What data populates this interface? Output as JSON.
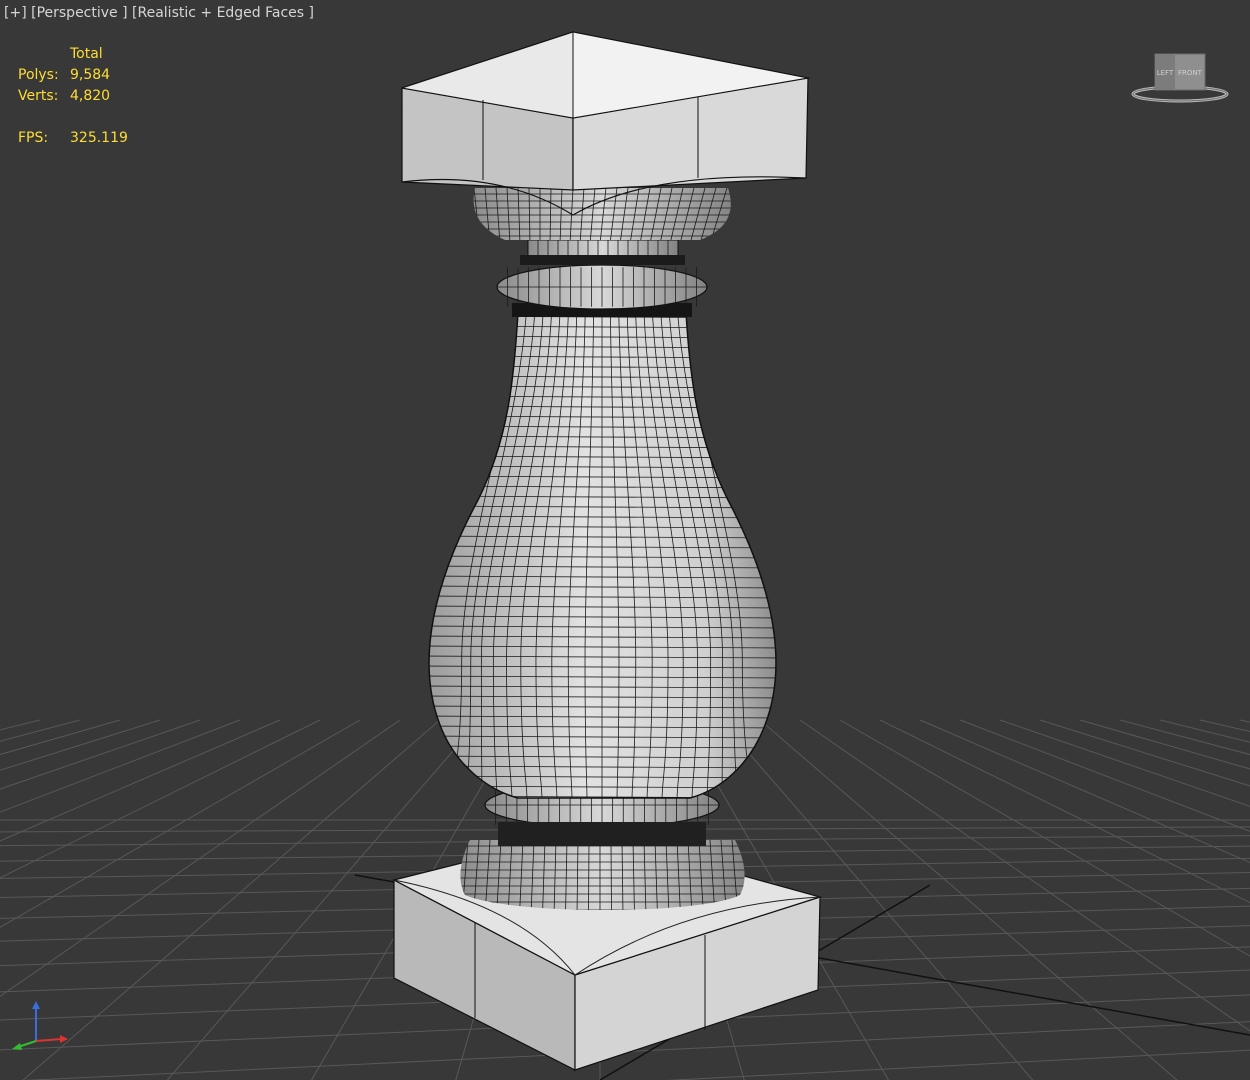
{
  "viewport": {
    "menu_label": "[+]",
    "view_label": "[Perspective ]",
    "shading_label": "[Realistic + Edged Faces ]"
  },
  "stats": {
    "header": "Total",
    "polys_label": "Polys:",
    "polys_value": "9,584",
    "verts_label": "Verts:",
    "verts_value": "4,820",
    "fps_label": "FPS:",
    "fps_value": "325.119"
  },
  "viewcube": {
    "face_front": "FRONT",
    "face_left": "LEFT"
  },
  "colors": {
    "background": "#383838",
    "stats_text": "#ffdd33",
    "label_text": "#d6d6d6",
    "grid": "#5a5a5a",
    "model": "#c9c9c9",
    "axis_x": "#cc3333",
    "axis_y": "#33aa33",
    "axis_z": "#3366dd"
  }
}
